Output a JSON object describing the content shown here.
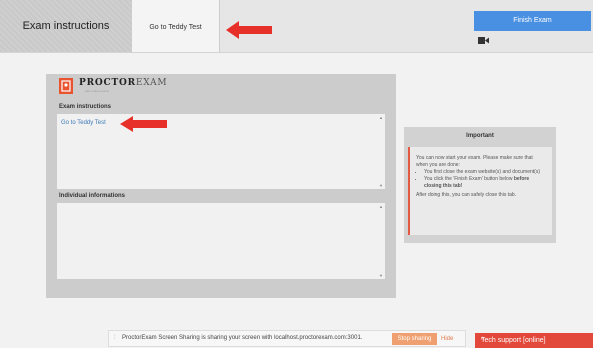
{
  "header": {
    "title_tab": "Exam instructions",
    "link_tab": "Go to Teddy Test",
    "finish_button": "Finish Exam"
  },
  "logo": {
    "brand_bold": "PROCTOR",
    "brand_light": "EXAM",
    "tagline": "safe online exams"
  },
  "instructions": {
    "label": "Exam instructions",
    "link": "Go to Teddy Test"
  },
  "individual": {
    "label": "Individual informations"
  },
  "important": {
    "title": "Important",
    "intro": "You can now start your exam. Please make sure that when you are done:",
    "bullet1": "You first close the exam website(s) and document(s)",
    "bullet2_prefix": "You click the 'Finish Exam' button below",
    "bullet2_bold": "before closing this tab!",
    "outro": "After doing this, you can safely close this tab."
  },
  "share_bar": {
    "handle": "⁞",
    "text": "ProctorExam Screen Sharing is sharing your screen with localhost.proctorexam.com:3001.",
    "stop_label": "Stop sharing",
    "hide_label": "Hide"
  },
  "tech_support": {
    "label": "Tech support [online]",
    "caret": "^"
  },
  "icons": {
    "camera": "camera-icon",
    "arrow": "red-arrow-icon",
    "logo": "proctorexam-logo-icon"
  },
  "colors": {
    "accent_blue": "#4a90e2",
    "arrow_red": "#e8302a",
    "brand_orange": "#e8542f",
    "tech_red": "#e2493b"
  }
}
